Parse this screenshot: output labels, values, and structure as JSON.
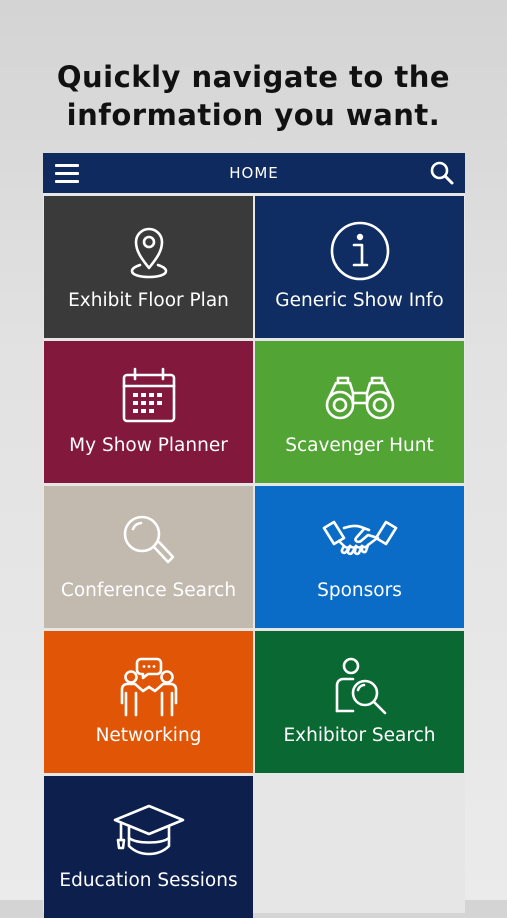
{
  "headline": {
    "line1": "Quickly navigate to the",
    "line2": "information you want."
  },
  "topbar": {
    "title": "HOME",
    "menu_icon": "hamburger-menu-icon",
    "search_icon": "search-icon"
  },
  "tiles": [
    {
      "label": "Exhibit Floor Plan",
      "icon": "map-pin-icon",
      "color": "#3a3a3a"
    },
    {
      "label": "Generic Show Info",
      "icon": "info-icon",
      "color": "#0f2d63"
    },
    {
      "label": "My Show Planner",
      "icon": "calendar-icon",
      "color": "#82183b"
    },
    {
      "label": "Scavenger Hunt",
      "icon": "binoculars-icon",
      "color": "#52a535"
    },
    {
      "label": "Conference Search",
      "icon": "magnifier-icon",
      "color": "#c2b9af"
    },
    {
      "label": "Sponsors",
      "icon": "handshake-icon",
      "color": "#0a6cc7"
    },
    {
      "label": "Networking",
      "icon": "people-chat-icon",
      "color": "#e05606"
    },
    {
      "label": "Exhibitor Search",
      "icon": "person-search-icon",
      "color": "#0a6832"
    },
    {
      "label": "Education Sessions",
      "icon": "graduation-cap-icon",
      "color": "#0d1f4d"
    }
  ]
}
